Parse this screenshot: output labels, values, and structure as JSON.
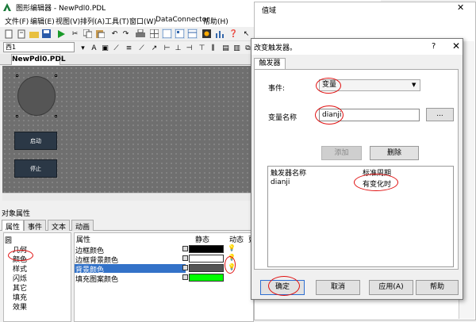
{
  "main_window": {
    "title": "图形编辑器 - NewPdl0.PDL",
    "controls": {
      "minimize": "—",
      "maximize": "☐",
      "close": "✕"
    }
  },
  "menubar": {
    "items": [
      "文件(F)",
      "编辑(E)",
      "视图(V)",
      "排列(A)",
      "工具(T)",
      "窗口(W)",
      "DataConnector",
      "帮助(H)"
    ]
  },
  "toolbar": {
    "font_select": "西1"
  },
  "document_tab": {
    "label": "NewPdl0.PDL"
  },
  "canvas": {
    "buttons": [
      "启动",
      "停止"
    ]
  },
  "object_properties": {
    "title": "对象属性",
    "tabs": [
      "属性",
      "事件",
      "文本",
      "动画"
    ],
    "tree": [
      "圆",
      "几何",
      "颜色",
      "样式",
      "闪烁",
      "其它",
      "填充",
      "效果"
    ],
    "grid_headers": {
      "property": "属性",
      "static": "静态",
      "dynamic": "动态",
      "extra": "更"
    },
    "rows": [
      {
        "label": "边框颜色",
        "color": "#000000"
      },
      {
        "label": "边框背景颜色",
        "color": "#ffffff"
      },
      {
        "label": "背景颜色",
        "color": "#555555"
      },
      {
        "label": "填充图案颜色",
        "color": "#00ff00"
      }
    ]
  },
  "bg_dialog": {
    "title": "值域",
    "close": "✕"
  },
  "trigger_dialog": {
    "title": "改变触发器。",
    "help": "?",
    "close": "✕",
    "tab": "触发器",
    "event_label": "事件:",
    "event_value": "变量",
    "varname_label": "变量名称",
    "varname_value": "dianji",
    "browse_label": "...",
    "add_label": "添加",
    "delete_label": "删除",
    "list_headers": [
      "触发器名称",
      "标准周期"
    ],
    "list_rows": [
      [
        "dianji",
        "有变化时"
      ]
    ],
    "buttons": {
      "ok": "确定",
      "cancel": "取消",
      "apply": "应用(A)",
      "help": "帮助"
    }
  }
}
